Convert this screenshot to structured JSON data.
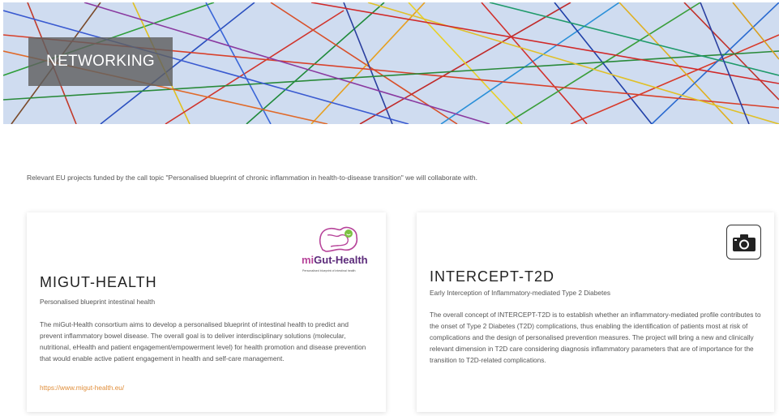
{
  "hero": {
    "title": "NETWORKING"
  },
  "intro": {
    "text": "Relevant EU projects funded by the call topic \"Personalised blueprint of chronic inflammation in health-to-disease transition\" we will collaborate with."
  },
  "projects": [
    {
      "title": "MIGUT-HEALTH",
      "subtitle": "Personalised blueprint intestinal health",
      "description": "The miGut-Health consortium aims to develop a personalised blueprint of intestinal health to predict and prevent inflammatory bowel disease. The overall goal is to deliver interdisciplinary solutions (molecular, nutritional, eHealth and patient engagement/empowerment level) for health promotion and disease prevention that would enable active patient engagement in health and self-care management.",
      "link": "https://www.migut-health.eu/",
      "logo": {
        "name_mi": "mi",
        "name_rest": "Gut-Health",
        "tagline": "Personalised blueprint of intestinal health",
        "icon": "migut-health-logo"
      }
    },
    {
      "title": "INTERCEPT-T2D",
      "subtitle": "Early Interception of Inflammatory-mediated Type 2 Diabetes",
      "description": "The overall concept of INTERCEPT-T2D is to establish whether an inflammatory-mediated profile contributes to the onset of Type 2 Diabetes (T2D) complications, thus enabling the identification of patients most at risk of complications and the design of personalised prevention measures. The project will bring a new and clinically relevant dimension in T2D care considering diagnosis inflammatory parameters that are of importance for the transition to T2D-related complications.",
      "icon": "camera-icon"
    }
  ],
  "colors": {
    "link": "#e08e3a",
    "logo_pink": "#b7449a",
    "logo_purple": "#5b2a7a",
    "hero_bg": "#c9d8ee"
  }
}
